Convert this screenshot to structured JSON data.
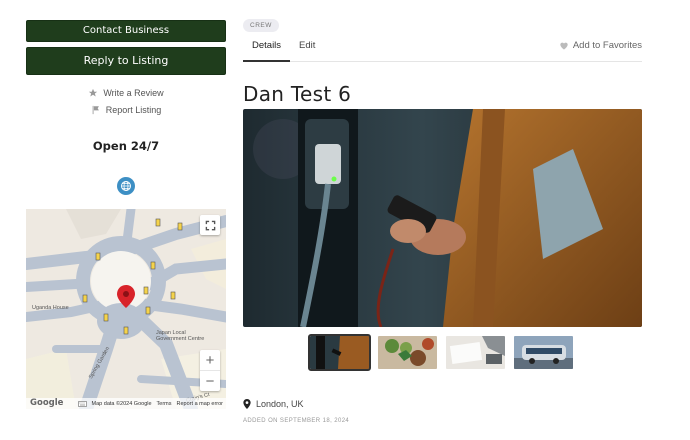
{
  "left": {
    "contact_label": "Contact Business",
    "reply_label": "Reply to Listing",
    "write_review_label": "Write a Review",
    "report_label": "Report Listing",
    "open_hours": "Open 24/7"
  },
  "map": {
    "labels": {
      "uganda_house": "Uganda House",
      "japan_centre": "Japan Local Government Centre",
      "spring_gardens": "Spring Garden",
      "craigs_court": "Craig's Ct"
    },
    "google": "Google",
    "attribution": "Map data ©2024 Google",
    "terms": "Terms",
    "report_error": "Report a map error",
    "zoom_in": "+",
    "zoom_out": "−"
  },
  "listing": {
    "badge": "CREW",
    "tabs": [
      "Details",
      "Edit"
    ],
    "favorites_label": "Add to Favorites",
    "title": "Dan Test 6",
    "location": "London, UK",
    "added": "ADDED ON SEPTEMBER 18, 2024"
  },
  "colors": {
    "button_dark": "#1f3d1c",
    "globe": "#3d8fc4",
    "map_pin": "#d8232a"
  }
}
